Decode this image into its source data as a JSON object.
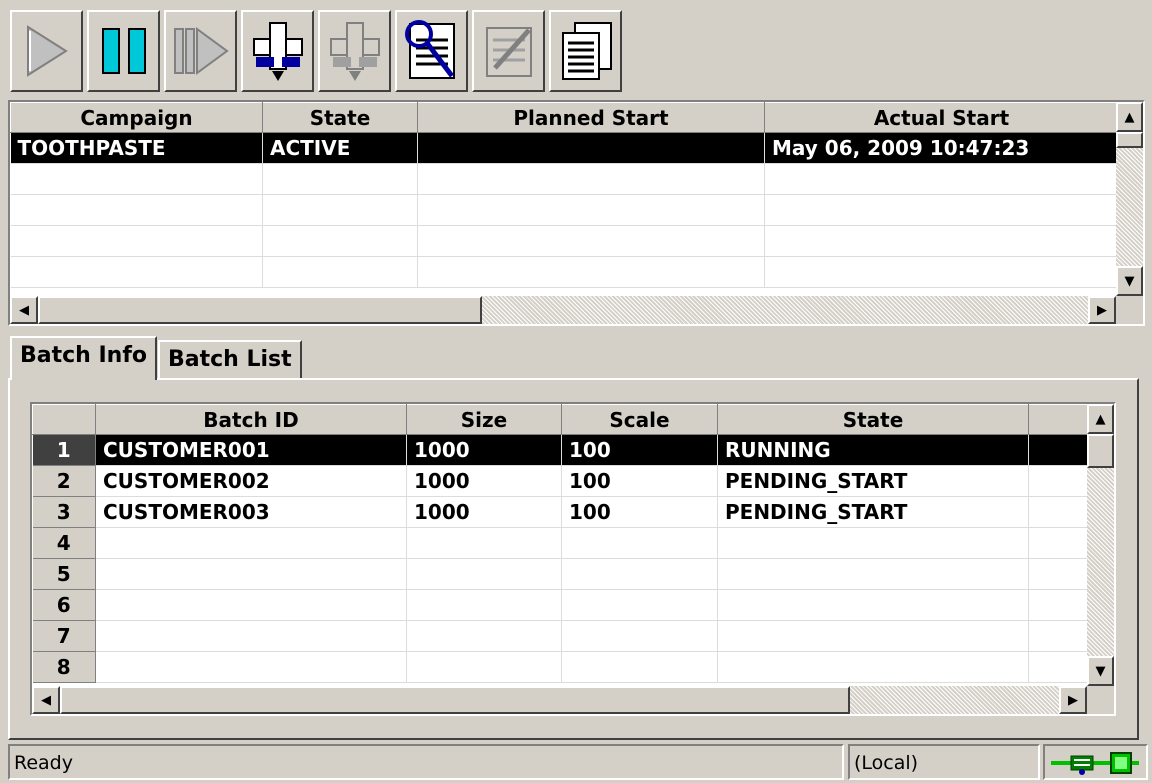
{
  "toolbar": {
    "buttons": [
      {
        "name": "run",
        "icon": "play-icon",
        "enabled": false
      },
      {
        "name": "pause",
        "icon": "pause-icon",
        "enabled": true
      },
      {
        "name": "step",
        "icon": "step-forward-icon",
        "enabled": false
      },
      {
        "name": "add",
        "icon": "add-campaign-icon",
        "enabled": true
      },
      {
        "name": "remove",
        "icon": "remove-campaign-icon",
        "enabled": false
      },
      {
        "name": "view",
        "icon": "magnifier-list-icon",
        "enabled": true
      },
      {
        "name": "edit",
        "icon": "edit-pencil-icon",
        "enabled": false
      },
      {
        "name": "report",
        "icon": "copy-pages-icon",
        "enabled": true
      }
    ]
  },
  "campaign_grid": {
    "columns": [
      "Campaign",
      "State",
      "Planned Start",
      "Actual Start"
    ],
    "rows": [
      {
        "campaign": "TOOTHPASTE",
        "state": "ACTIVE",
        "planned_start": "",
        "actual_start": "May 06, 2009 10:47:23",
        "selected": true
      }
    ],
    "empty_rows": 4
  },
  "tabs": [
    {
      "label": "Batch Info",
      "active": true
    },
    {
      "label": "Batch List",
      "active": false
    }
  ],
  "batch_grid": {
    "columns": [
      "Batch ID",
      "Size",
      "Scale",
      "State"
    ],
    "rows": [
      {
        "num": "1",
        "batch_id": "CUSTOMER001",
        "size": "1000",
        "scale": "100",
        "state": "RUNNING",
        "selected": true
      },
      {
        "num": "2",
        "batch_id": "CUSTOMER002",
        "size": "1000",
        "scale": "100",
        "state": "PENDING_START",
        "selected": false
      },
      {
        "num": "3",
        "batch_id": "CUSTOMER003",
        "size": "1000",
        "scale": "100",
        "state": "PENDING_START",
        "selected": false
      },
      {
        "num": "4",
        "batch_id": "",
        "size": "",
        "scale": "",
        "state": "",
        "selected": false
      },
      {
        "num": "5",
        "batch_id": "",
        "size": "",
        "scale": "",
        "state": "",
        "selected": false
      },
      {
        "num": "6",
        "batch_id": "",
        "size": "",
        "scale": "",
        "state": "",
        "selected": false
      },
      {
        "num": "7",
        "batch_id": "",
        "size": "",
        "scale": "",
        "state": "",
        "selected": false
      },
      {
        "num": "8",
        "batch_id": "",
        "size": "",
        "scale": "",
        "state": "",
        "selected": false
      }
    ]
  },
  "status_bar": {
    "message": "Ready",
    "server": "(Local)",
    "connection_icon": "network-connection-icon"
  },
  "colors": {
    "face": "#d4d0c8",
    "selection": "#000000",
    "accent_cyan": "#00c8d8",
    "accent_blue": "#0000a0",
    "status_green": "#00c000"
  }
}
